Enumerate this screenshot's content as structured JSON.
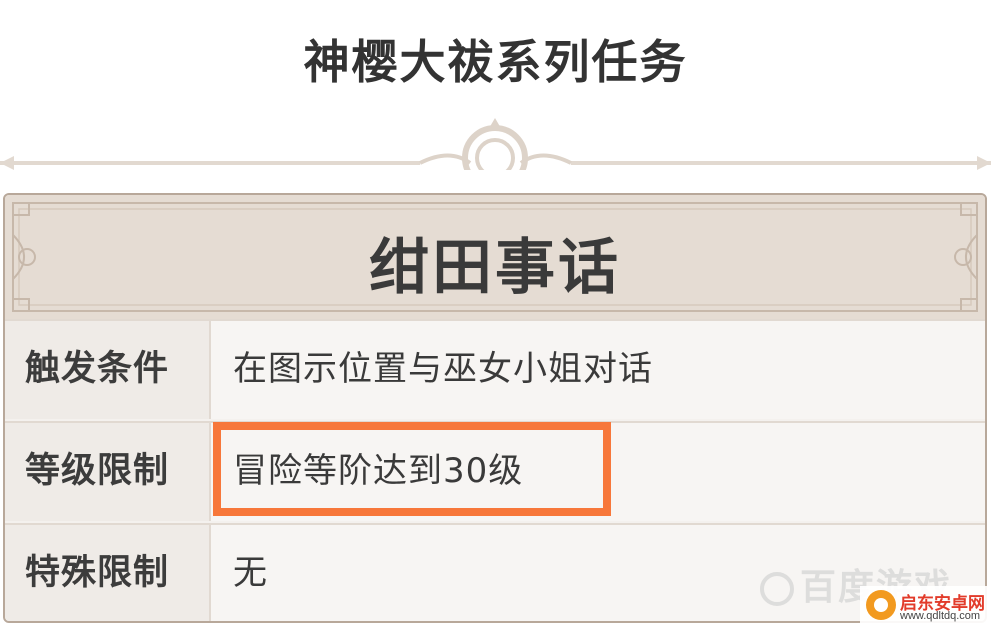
{
  "page": {
    "title": "神樱大祓系列任务"
  },
  "card": {
    "title": "绀田事话",
    "rows": [
      {
        "label": "触发条件",
        "value": "在图示位置与巫女小姐对话"
      },
      {
        "label": "等级限制",
        "value": "冒险等阶达到30级"
      },
      {
        "label": "特殊限制",
        "value": "无"
      }
    ]
  },
  "highlight": {
    "color": "#f7773a"
  },
  "watermarks": {
    "baidu_text": "百度游戏",
    "site_name": "启东安卓网",
    "site_url": "www.qdltdq.com"
  },
  "colors": {
    "header_bg": "#e5dcd3",
    "label_bg": "#efebe7",
    "value_bg": "#f7f5f3",
    "border": "#b8a89a",
    "ornament": "#ddd3c9"
  }
}
